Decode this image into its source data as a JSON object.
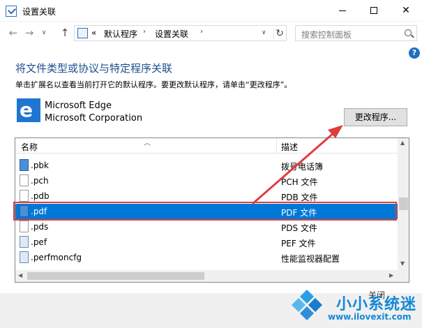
{
  "window": {
    "title": "设置关联",
    "minimize": "—",
    "maximize": "☐",
    "close": "✕"
  },
  "nav": {
    "back": "←",
    "forward": "→",
    "recent": "∨",
    "up": "↑",
    "breadcrumb_prefix": "«",
    "breadcrumb": [
      "默认程序",
      "设置关联"
    ],
    "breadcrumb_sep": "›",
    "dropdown": "∨",
    "refresh": "↻",
    "search_placeholder": "搜索控制面板"
  },
  "help": "?",
  "heading": "将文件类型或协议与特定程序关联",
  "description": "单击扩展名以查看当前打开它的默认程序。要更改默认程序，请单击“更改程序”。",
  "app": {
    "logo_letter": "e",
    "name": "Microsoft Edge",
    "company": "Microsoft Corporation",
    "change_button": "更改程序..."
  },
  "list": {
    "columns": [
      "名称",
      "描述"
    ],
    "rows": [
      {
        "ext": ".pbk",
        "desc": "拨号电话簿",
        "icon": "phonebook-icon",
        "selected": false
      },
      {
        "ext": ".pch",
        "desc": "PCH 文件",
        "icon": "file-icon",
        "selected": false
      },
      {
        "ext": ".pdb",
        "desc": "PDB 文件",
        "icon": "file-icon",
        "selected": false
      },
      {
        "ext": ".pdf",
        "desc": "PDF 文件",
        "icon": "pdf-icon",
        "selected": true
      },
      {
        "ext": ".pds",
        "desc": "PDS 文件",
        "icon": "file-icon",
        "selected": false
      },
      {
        "ext": ".pef",
        "desc": "PEF 文件",
        "icon": "image-file-icon",
        "selected": false
      },
      {
        "ext": ".perfmoncfg",
        "desc": "性能监视器配置",
        "icon": "perfmon-file-icon",
        "selected": false
      }
    ]
  },
  "footer": {
    "close_button": "关闭"
  },
  "watermark": {
    "title": "小小系统迷",
    "url": "www.ilovexit.com"
  },
  "colors": {
    "accent": "#0078d7",
    "heading": "#1f4e8c",
    "annotation": "#e03c3c",
    "watermark": "#1288d8"
  }
}
